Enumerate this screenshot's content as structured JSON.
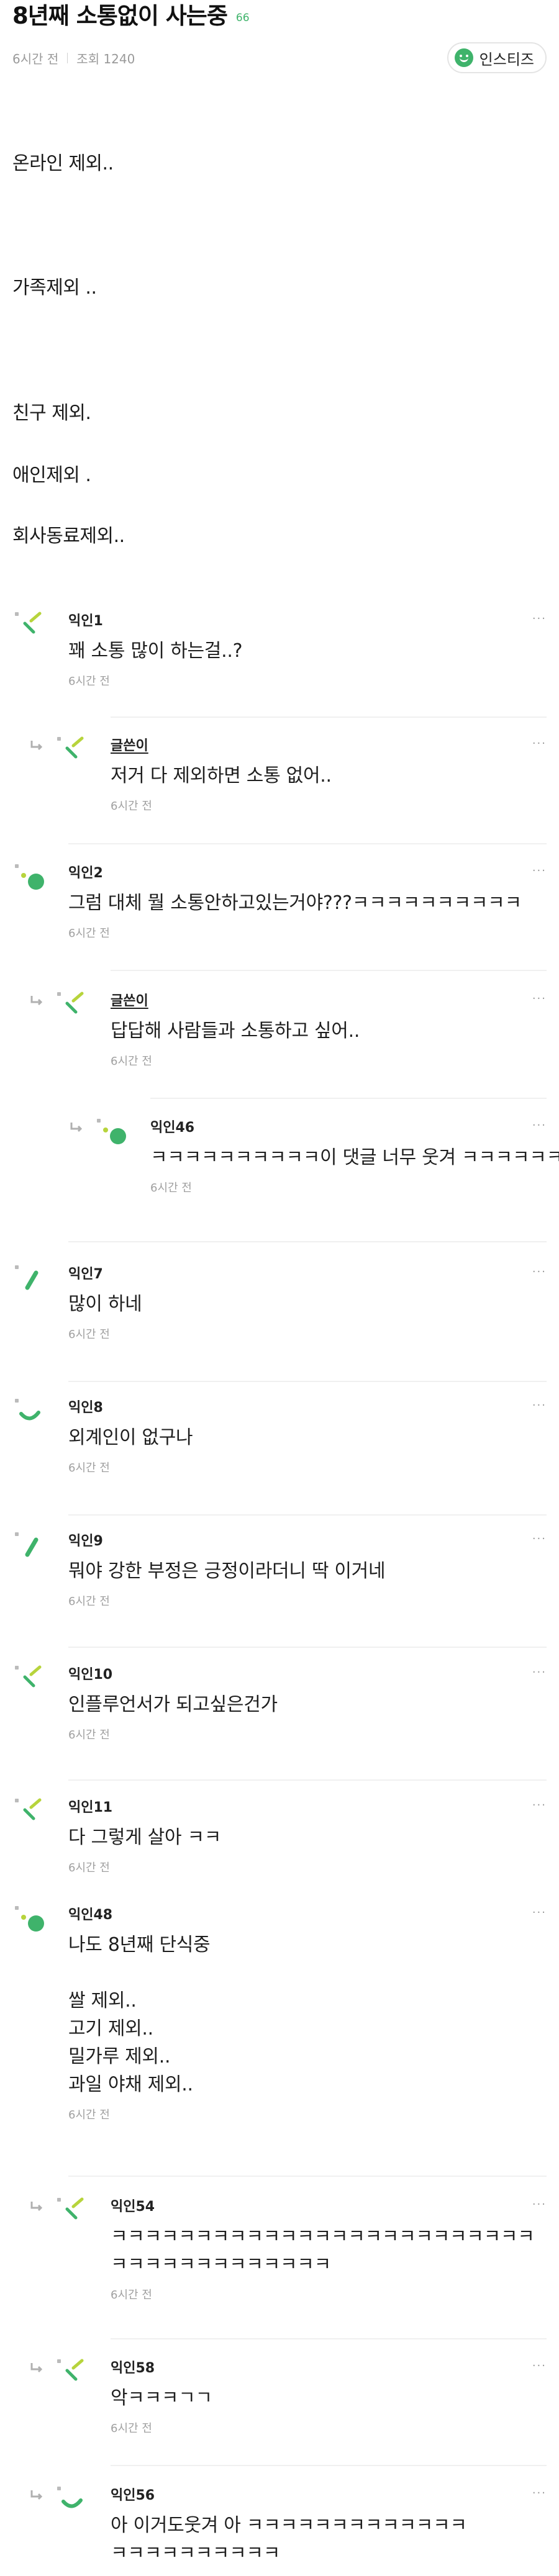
{
  "post": {
    "title": "8년째 소통없이 사는중",
    "comment_count": "66",
    "time": "6시간 전",
    "views": "조회 1240",
    "category": "인스티즈",
    "body_lines": [
      "온라인 제외..",
      "가족제외 ..",
      "친구 제외.",
      "애인제외 .",
      "회사동료제외.."
    ]
  },
  "comments": [
    {
      "author": "익인1",
      "writer": false,
      "depth": 0,
      "lines": [
        "꽤 소통 많이 하는걸..?"
      ],
      "time": "6시간 전",
      "avatar": "leaf-green"
    },
    {
      "author": "글쓴이",
      "writer": true,
      "depth": 1,
      "lines": [
        "저거 다 제외하면 소통 없어.."
      ],
      "time": "6시간 전",
      "avatar": "leaf-green"
    },
    {
      "author": "익인2",
      "writer": false,
      "depth": 0,
      "lines": [
        "그럼 대체 뭘 소통안하고있는거야???ㅋㅋㅋㅋㅋㅋㅋㅋㅋㅋ"
      ],
      "time": "6시간 전",
      "avatar": "dot-green"
    },
    {
      "author": "글쓴이",
      "writer": true,
      "depth": 1,
      "lines": [
        "답답해 사람들과 소통하고 싶어.."
      ],
      "time": "6시간 전",
      "avatar": "leaf-green"
    },
    {
      "author": "익인46",
      "writer": false,
      "depth": 2,
      "lines": [
        "ㅋㅋㅋㅋㅋㅋㅋㅋㅋㅋ이 댓글 너무 웃겨 ㅋㅋㅋㅋㅋㅋ"
      ],
      "time": "6시간 전",
      "avatar": "dot-green"
    },
    {
      "author": "익인7",
      "writer": false,
      "depth": 0,
      "lines": [
        "많이 하네"
      ],
      "time": "6시간 전",
      "avatar": "stroke-green"
    },
    {
      "author": "익인8",
      "writer": false,
      "depth": 0,
      "lines": [
        "외계인이 없구나"
      ],
      "time": "6시간 전",
      "avatar": "smile-green"
    },
    {
      "author": "익인9",
      "writer": false,
      "depth": 0,
      "lines": [
        "뭐야 강한 부정은 긍정이라더니 딱 이거네"
      ],
      "time": "6시간 전",
      "avatar": "stroke-green"
    },
    {
      "author": "익인10",
      "writer": false,
      "depth": 0,
      "lines": [
        "인플루언서가 되고싶은건가"
      ],
      "time": "6시간 전",
      "avatar": "leaf-lime"
    },
    {
      "author": "익인11",
      "writer": false,
      "depth": 0,
      "lines": [
        "다 그렇게 살아 ㅋㅋ"
      ],
      "time": "6시간 전",
      "avatar": "leaf-lime"
    },
    {
      "author": "익인48",
      "writer": false,
      "depth": 0,
      "lines": [
        "나도 8년째 단식중",
        "",
        "쌀 제외..",
        "고기 제외..",
        "밀가루 제외..",
        "과일 야채 제외.."
      ],
      "time": "6시간 전",
      "avatar": "dot-green"
    },
    {
      "author": "익인54",
      "writer": false,
      "depth": 1,
      "lines": [
        "ㅋㅋㅋㅋㅋㅋㅋㅋㅋㅋㅋㅋㅋㅋㅋㅋㅋㅋㅋㅋㅋㅋㅋㅋㅋ",
        "ㅋㅋㅋㅋㅋㅋㅋㅋㅋㅋㅋㅋㅋ"
      ],
      "time": "6시간 전",
      "avatar": "leaf-green"
    },
    {
      "author": "익인58",
      "writer": false,
      "depth": 1,
      "lines": [
        "악ㅋㅋㅋㄱㄱ"
      ],
      "time": "6시간 전",
      "avatar": "leaf-green"
    },
    {
      "author": "익인56",
      "writer": false,
      "depth": 1,
      "lines": [
        "아 이거도웃겨 아 ㅋㅋㅋㅋㅋㅋㅋㅋㅋㅋㅋㅋㅋ",
        "ㅋㅋㅋㅋㅋㅋㅋㅋㅋㅋ"
      ],
      "time": "",
      "avatar": "smile-green"
    }
  ],
  "more_label": "···",
  "colors": {
    "accent": "#3fb36b",
    "lime": "#b7d43c",
    "meta": "#9a9a9a"
  }
}
